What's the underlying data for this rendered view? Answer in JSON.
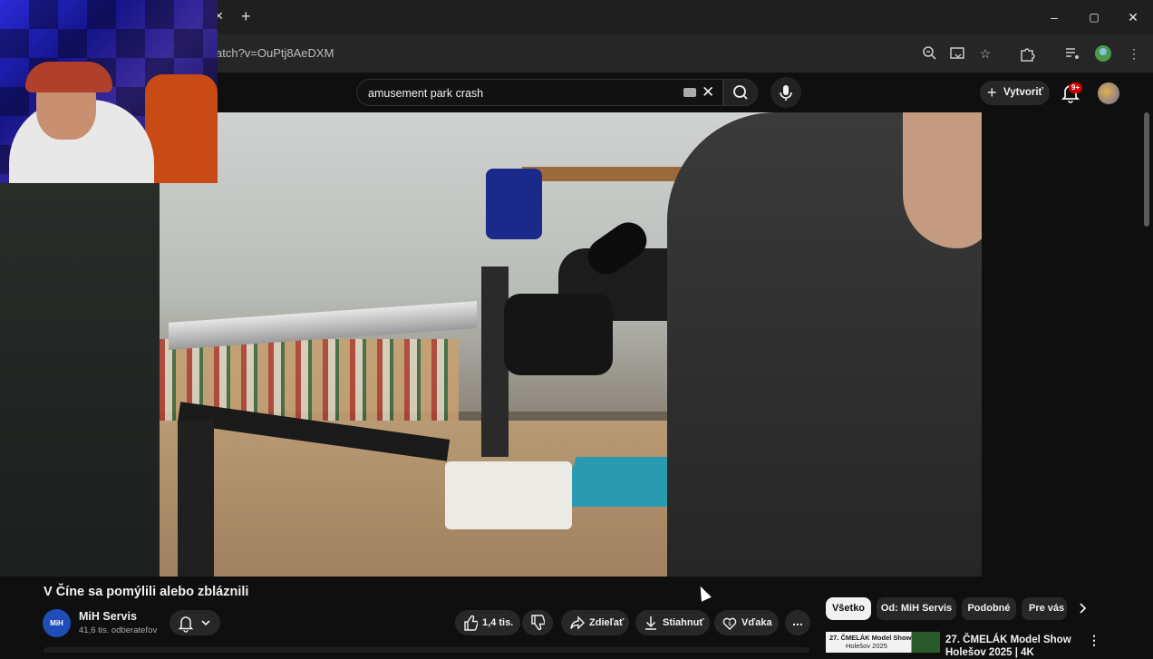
{
  "browser": {
    "url_fragment": "atch?v=OuPtj8AeDXM",
    "window_controls": [
      "–",
      "▢",
      "✕"
    ]
  },
  "header": {
    "search_query": "amusement park crash",
    "create_label": "Vytvoriť",
    "notifications_badge": "9+"
  },
  "video": {
    "title": "V Číne sa pomýlili alebo zbláznili"
  },
  "channel": {
    "avatar_text": "MiH",
    "name": "MiH Servis",
    "subscribers": "41,6 tis. odberateľov"
  },
  "actions": {
    "likes": "1,4 tis.",
    "share_label": "Zdieľať",
    "download_label": "Stiahnuť",
    "thanks_label": "Vďaka",
    "more_label": "..."
  },
  "chips": [
    {
      "label": "Všetko",
      "active": true
    },
    {
      "label": "Od: MiH Servis",
      "active": false
    },
    {
      "label": "Podobné",
      "active": false
    },
    {
      "label": "Pre vás",
      "active": false
    }
  ],
  "recommendation": {
    "thumb_line1": "27. ČMELÁK Model Show",
    "thumb_line2": "Holešov 2025",
    "title": "27. ČMELÁK Model Show Holešov 2025 | 4K"
  },
  "icons": {
    "search": "search-icon",
    "mic": "mic-icon",
    "bell": "bell-icon",
    "like": "thumbs-up-icon",
    "dislike": "thumbs-down-icon",
    "share": "share-icon",
    "download": "download-icon",
    "thanks": "heart-dollar-icon"
  },
  "colors": {
    "background": "#0f0f0f",
    "badge": "#cc0000",
    "channel_avatar": "#1f4db8"
  }
}
